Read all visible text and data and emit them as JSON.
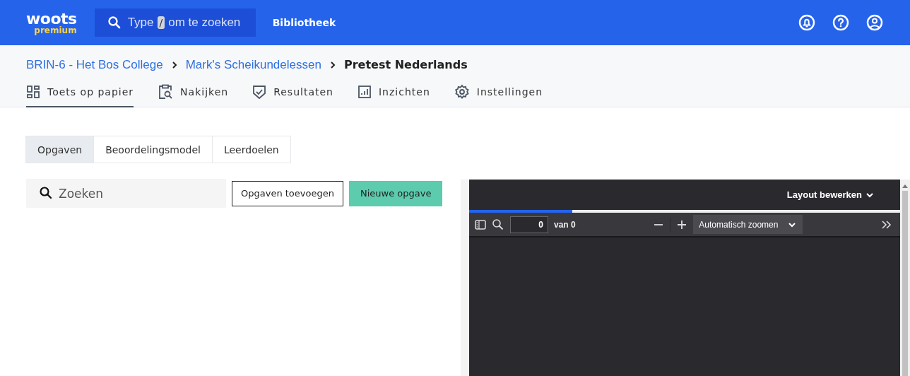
{
  "header": {
    "logo": {
      "word": "woots",
      "sub": "premium"
    },
    "search": {
      "before": "Type",
      "key": "/",
      "after": "om te zoeken"
    },
    "nav_link": "Bibliotheek"
  },
  "breadcrumb": [
    {
      "label": "BRIN-6 - Het Bos College",
      "kind": "link"
    },
    {
      "label": "Mark's Scheikundelessen",
      "kind": "link"
    },
    {
      "label": "Pretest Nederlands",
      "kind": "current"
    }
  ],
  "tabs": [
    {
      "label": "Toets op papier",
      "selected": true
    },
    {
      "label": "Nakijken",
      "selected": false
    },
    {
      "label": "Resultaten",
      "selected": false
    },
    {
      "label": "Inzichten",
      "selected": false
    },
    {
      "label": "Instellingen",
      "selected": false
    }
  ],
  "segments": [
    {
      "label": "Opgaven",
      "selected": true
    },
    {
      "label": "Beoordelingsmodel",
      "selected": false
    },
    {
      "label": "Leerdoelen",
      "selected": false
    }
  ],
  "search": {
    "placeholder": "Zoeken"
  },
  "buttons": [
    {
      "label": "Opgaven toevoegen",
      "kind": "outline"
    },
    {
      "label": "Nieuwe opgave",
      "kind": "primary"
    }
  ],
  "viewer": {
    "layout_button": "Layout bewerken",
    "progress": {
      "level": 0.24
    },
    "page_input": "0",
    "page_total": "van 0",
    "zoom": "Automatisch zoomen"
  }
}
